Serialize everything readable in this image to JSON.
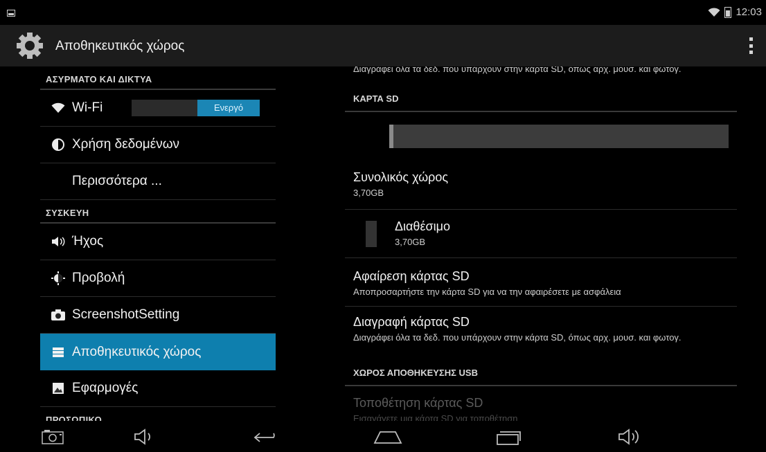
{
  "status_bar": {
    "time": "12:03"
  },
  "action_bar": {
    "title": "Αποθηκευτικός χώρος",
    "overflow_icon": "more-vertical-icon"
  },
  "left_panel": {
    "sections": [
      {
        "header": "ΑΣΥΡΜΑΤΟ ΚΑΙ ΔΙΚΤΥΑ",
        "items": [
          {
            "label": "Wi-Fi",
            "icon": "wifi-icon",
            "toggle": "Ενεργό"
          },
          {
            "label": "Χρήση δεδομένων",
            "icon": "data-usage-icon"
          },
          {
            "label": "Περισσότερα ..."
          }
        ]
      },
      {
        "header": "ΣΥΣΚΕΥΗ",
        "items": [
          {
            "label": "Ήχος",
            "icon": "sound-icon"
          },
          {
            "label": "Προβολή",
            "icon": "display-icon"
          },
          {
            "label": "ScreenshotSetting",
            "icon": "camera-icon"
          },
          {
            "label": "Αποθηκευτικός χώρος",
            "icon": "storage-icon",
            "active": true
          },
          {
            "label": "Εφαρμογές",
            "icon": "apps-icon"
          }
        ]
      },
      {
        "header": "ΠΡΟΣΩΠΙΚΟ"
      }
    ]
  },
  "right_panel": {
    "top_partial_text": "Διαγράφει όλα τα δεδ. που υπάρχουν στην κάρτα SD, όπως αρχ. μουσ. και φωτογ.",
    "sd_header": "ΚΑΡΤΑ SD",
    "storage_bar_used_fraction": 0.01,
    "total": {
      "title": "Συνολικός χώρος",
      "value": "3,70GB"
    },
    "available": {
      "title": "Διαθέσιμο",
      "value": "3,70GB"
    },
    "unmount": {
      "title": "Αφαίρεση κάρτας SD",
      "subtitle": "Αποπροσαρτήστε την κάρτα SD για να την αφαιρέσετε με ασφάλεια"
    },
    "erase": {
      "title": "Διαγραφή κάρτας SD",
      "subtitle": "Διαγράφει όλα τα δεδ. που υπάρχουν στην κάρτα SD, όπως αρχ. μουσ. και φωτογ."
    },
    "usb_header": "ΧΩΡΟΣ ΑΠΟΘΗΚΕΥΣΗΣ USB",
    "mount": {
      "title": "Τοποθέτηση κάρτας SD",
      "subtitle": "Εισαγάγετε μια κάρτα SD για τοποθέτηση"
    }
  },
  "nav_bar": {
    "buttons": [
      "screenshot-icon",
      "volume-down-icon",
      "back-icon",
      "home-icon",
      "recents-icon",
      "volume-up-icon"
    ]
  }
}
